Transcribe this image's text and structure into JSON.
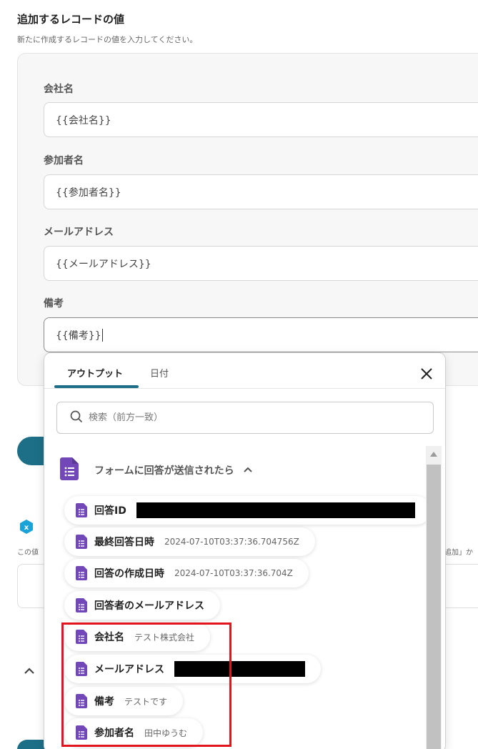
{
  "section": {
    "title": "追加するレコードの値",
    "description": "新たに作成するレコードの値を入力してください。"
  },
  "fields": [
    {
      "label": "会社名",
      "value": "{{会社名}}"
    },
    {
      "label": "参加者名",
      "value": "{{参加者名}}"
    },
    {
      "label": "メールアドレス",
      "value": "{{メールアドレス}}"
    },
    {
      "label": "備考",
      "value": "{{備考}}"
    }
  ],
  "background": {
    "desc_fragment": "この値",
    "right_fragment": "追加」か"
  },
  "popover": {
    "tabs": [
      {
        "label": "アウトプット",
        "active": true
      },
      {
        "label": "日付",
        "active": false
      }
    ],
    "search_placeholder": "検索（前方一致）",
    "group": {
      "title": "フォームに回答が送信されたら",
      "icon": "google-forms-icon",
      "expanded": true
    },
    "items": [
      {
        "label": "回答ID",
        "value": "",
        "redacted": true
      },
      {
        "label": "最終回答日時",
        "value": "2024-07-10T03:37:36.704756Z",
        "redacted": false
      },
      {
        "label": "回答の作成日時",
        "value": "2024-07-10T03:37:36.704Z",
        "redacted": false
      },
      {
        "label": "回答者のメールアドレス",
        "value": "",
        "redacted": false
      },
      {
        "label": "会社名",
        "value": "テスト株式会社",
        "redacted": false
      },
      {
        "label": "メールアドレス",
        "value": "",
        "redacted": true
      },
      {
        "label": "備考",
        "value": "テストです",
        "redacted": false
      },
      {
        "label": "参加者名",
        "value": "田中ゆうむ",
        "redacted": false
      }
    ]
  },
  "colors": {
    "accent": "#1d6f87",
    "forms_purple": "#7248b9",
    "highlight_red": "#e2141e"
  }
}
